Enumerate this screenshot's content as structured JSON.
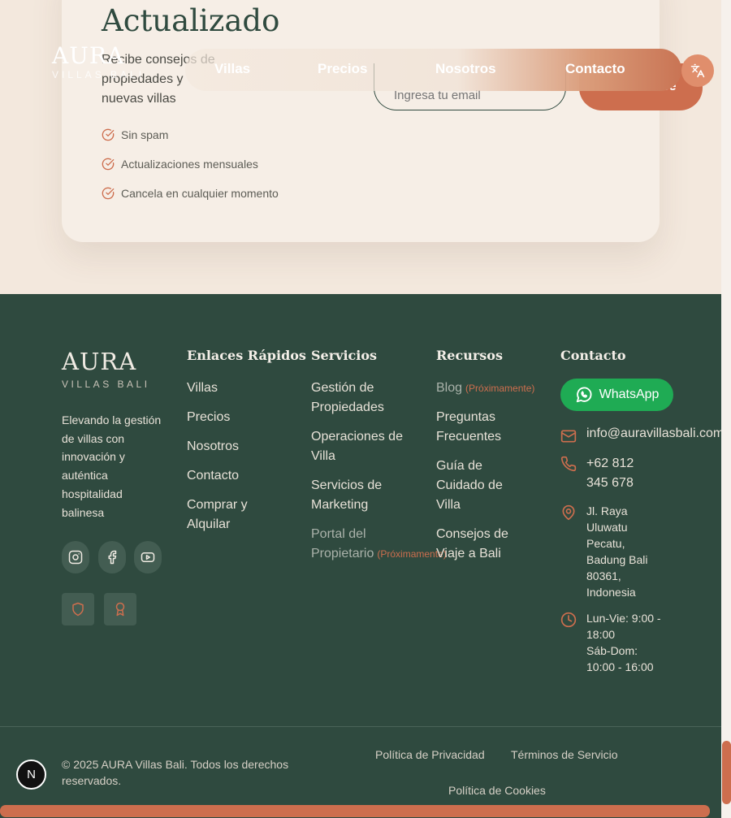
{
  "newsletter": {
    "title": "Actualizado",
    "description": "Recibe consejos de propiedades y nuevas villas",
    "features": [
      "Sin spam",
      "Actualizaciones mensuales",
      "Cancela en cualquier momento"
    ],
    "email_placeholder": "Ingresa tu email",
    "subscribe_label": "Suscribirse"
  },
  "header": {
    "logo_name": "AURA",
    "logo_sub": "VILLAS BALI",
    "nav": [
      "Villas",
      "Precios",
      "Nosotros",
      "Contacto"
    ],
    "lang_icon": "translate-icon"
  },
  "footer": {
    "logo_name": "AURA",
    "logo_sub": "VILLAS BALI",
    "tagline": "Elevando la gestión de villas con innovación y auténtica hospitalidad balinesa",
    "social_icons": [
      "instagram-icon",
      "facebook-icon",
      "youtube-icon"
    ],
    "badge_icons": [
      "shield-icon",
      "award-icon"
    ],
    "quick_links": {
      "heading": "Enlaces Rápidos",
      "items": [
        "Villas",
        "Precios",
        "Nosotros",
        "Contacto",
        "Comprar y Alquilar"
      ]
    },
    "services": {
      "heading": "Servicios",
      "items": [
        "Gestión de Propiedades",
        "Operaciones de Villa",
        "Servicios de Marketing",
        "Portal del Propietario"
      ],
      "soon_label": "(Próximamente)"
    },
    "resources": {
      "heading": "Recursos",
      "items": [
        "Blog",
        "Preguntas Frecuentes",
        "Guía de Cuidado de Villa",
        "Consejos de Viaje a Bali"
      ],
      "soon_label": "(Próximamente)"
    },
    "contact": {
      "heading": "Contacto",
      "whatsapp": "WhatsApp",
      "email": "info@auravillasbali.com",
      "phone": "+62 812 345 678",
      "address": "Jl. Raya Uluwatu Pecatu, Badung Bali 80361, Indonesia",
      "hours_weekday": "Lun-Vie: 9:00 - 18:00",
      "hours_weekend": "Sáb-Dom: 10:00 - 16:00"
    },
    "copyright": "© 2025 AURA Villas Bali. Todos los derechos reservados.",
    "legal": [
      "Política de Privacidad",
      "Términos de Servicio",
      "Política de Cookies"
    ]
  },
  "dev_badge": "N",
  "colors": {
    "accent": "#cd6e4e",
    "footer_bg": "#2f4a3f",
    "page_bg": "#f3e8dd",
    "whatsapp": "#1fab54"
  }
}
